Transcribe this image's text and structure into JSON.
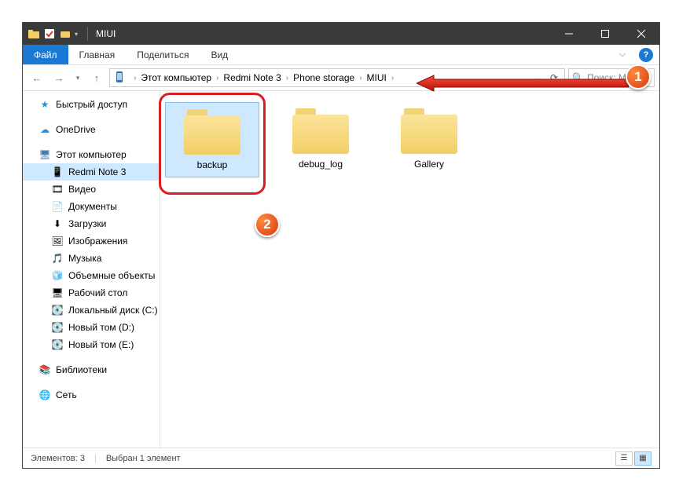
{
  "titlebar": {
    "title": "MIUI"
  },
  "ribbon": {
    "file": "Файл",
    "tabs": [
      "Главная",
      "Поделиться",
      "Вид"
    ]
  },
  "address": {
    "segments": [
      "Этот компьютер",
      "Redmi Note 3",
      "Phone storage",
      "MIUI"
    ],
    "search_placeholder": "Поиск: M..."
  },
  "nav": {
    "quick": "Быстрый доступ",
    "onedrive": "OneDrive",
    "thispc": "Этот компьютер",
    "children": [
      "Redmi Note 3",
      "Видео",
      "Документы",
      "Загрузки",
      "Изображения",
      "Музыка",
      "Объемные объекты",
      "Рабочий стол",
      "Локальный диск (C:)",
      "Новый том (D:)",
      "Новый том (E:)"
    ],
    "libraries": "Библиотеки",
    "network": "Сеть"
  },
  "folders": [
    {
      "name": "backup",
      "selected": true
    },
    {
      "name": "debug_log",
      "selected": false
    },
    {
      "name": "Gallery",
      "selected": false
    }
  ],
  "status": {
    "count": "Элементов: 3",
    "selected": "Выбран 1 элемент"
  },
  "badges": {
    "b1": "1",
    "b2": "2"
  }
}
